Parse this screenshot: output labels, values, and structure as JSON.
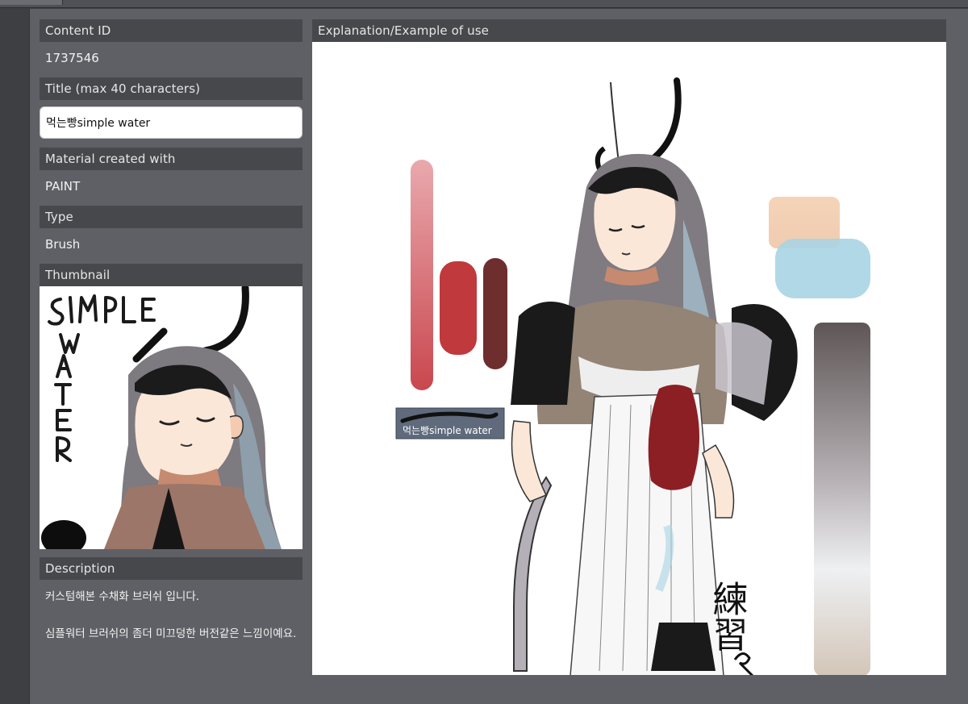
{
  "content": {
    "id_label": "Content ID",
    "id_value": "1737546",
    "title_label": "Title (max 40 characters)",
    "title_value": "먹는빵simple water",
    "material_label": "Material created with",
    "material_value": "PAINT",
    "type_label": "Type",
    "type_value": "Brush",
    "thumbnail_label": "Thumbnail",
    "thumbnail_text": "SIMPLE WATER",
    "description_label": "Description",
    "description_lines": [
      "커스텀해본 수채화 브러쉬 입니다.",
      "심플워터 브러쉬의 좀더 미끄덩한 버전같은 느낌이예요."
    ]
  },
  "example": {
    "label": "Explanation/Example of use",
    "brush_chip_label": "먹는빵simple water",
    "calligraphy": "練習"
  },
  "colors": {
    "background": "#3e3f43",
    "panel": "#5f6065",
    "section_header": "#47484c",
    "text": "#ececec",
    "input_bg": "#ffffff",
    "swatch_red_light": "#d9828a",
    "swatch_red": "#c0393c",
    "swatch_maroon": "#6e2e2e",
    "swatch_peach": "#f2d2b4",
    "swatch_blue": "#a9d4e4",
    "swatch_grey": "#6a6464"
  }
}
